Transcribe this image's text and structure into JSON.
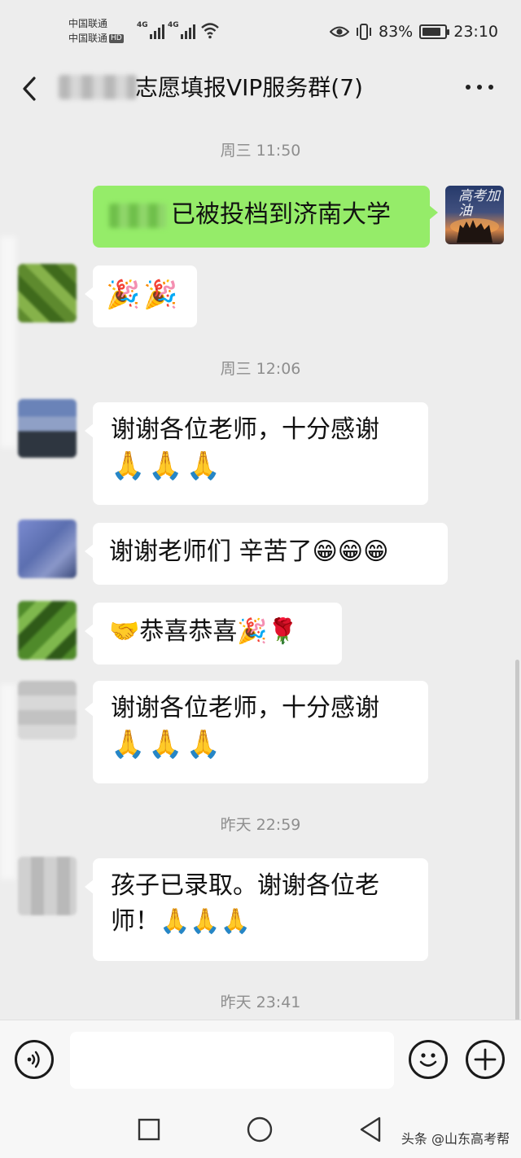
{
  "status_bar": {
    "carrier_1": "中国联通",
    "carrier_2": "中国联通",
    "hd_badge": "HD",
    "network_1": "4G",
    "network_2": "4G",
    "battery_percent": "83%",
    "battery_level": 0.83,
    "time": "23:10"
  },
  "header": {
    "title": "志愿填报VIP服务群(7)"
  },
  "messages": {
    "ts1": "周三 11:50",
    "m1_text": "已被投档到济南大学",
    "m1_avatar_text": "高考加油",
    "m2_emoji": "🎉🎉",
    "ts2": "周三 12:06",
    "m3_line1": "谢谢各位老师，十分感谢",
    "m3_emoji": "🙏🙏🙏",
    "m4_text": "谢谢老师们 辛苦了😁😁😁",
    "m5_text": "🤝恭喜恭喜🎉🌹",
    "m6_line1": "谢谢各位老师，十分感谢",
    "m6_emoji": "🙏🙏🙏",
    "ts3": "昨天 22:59",
    "m7_line1": "孩子已录取。谢谢各位老",
    "m7_line2": "师！🙏🙏🙏",
    "ts4": "昨天 23:41"
  },
  "input": {
    "placeholder": ""
  },
  "watermark": "头条 @山东高考帮",
  "colors": {
    "background": "#ededed",
    "self_bubble": "#95ec69",
    "other_bubble": "#ffffff",
    "timestamp": "#8e8e8e"
  },
  "icons": [
    "back-arrow-icon",
    "more-dots-icon",
    "voice-icon",
    "emoji-icon",
    "plus-icon",
    "eye-icon",
    "vibrate-icon",
    "wifi-icon",
    "battery-icon",
    "square-nav-icon",
    "circle-nav-icon",
    "triangle-nav-icon"
  ]
}
